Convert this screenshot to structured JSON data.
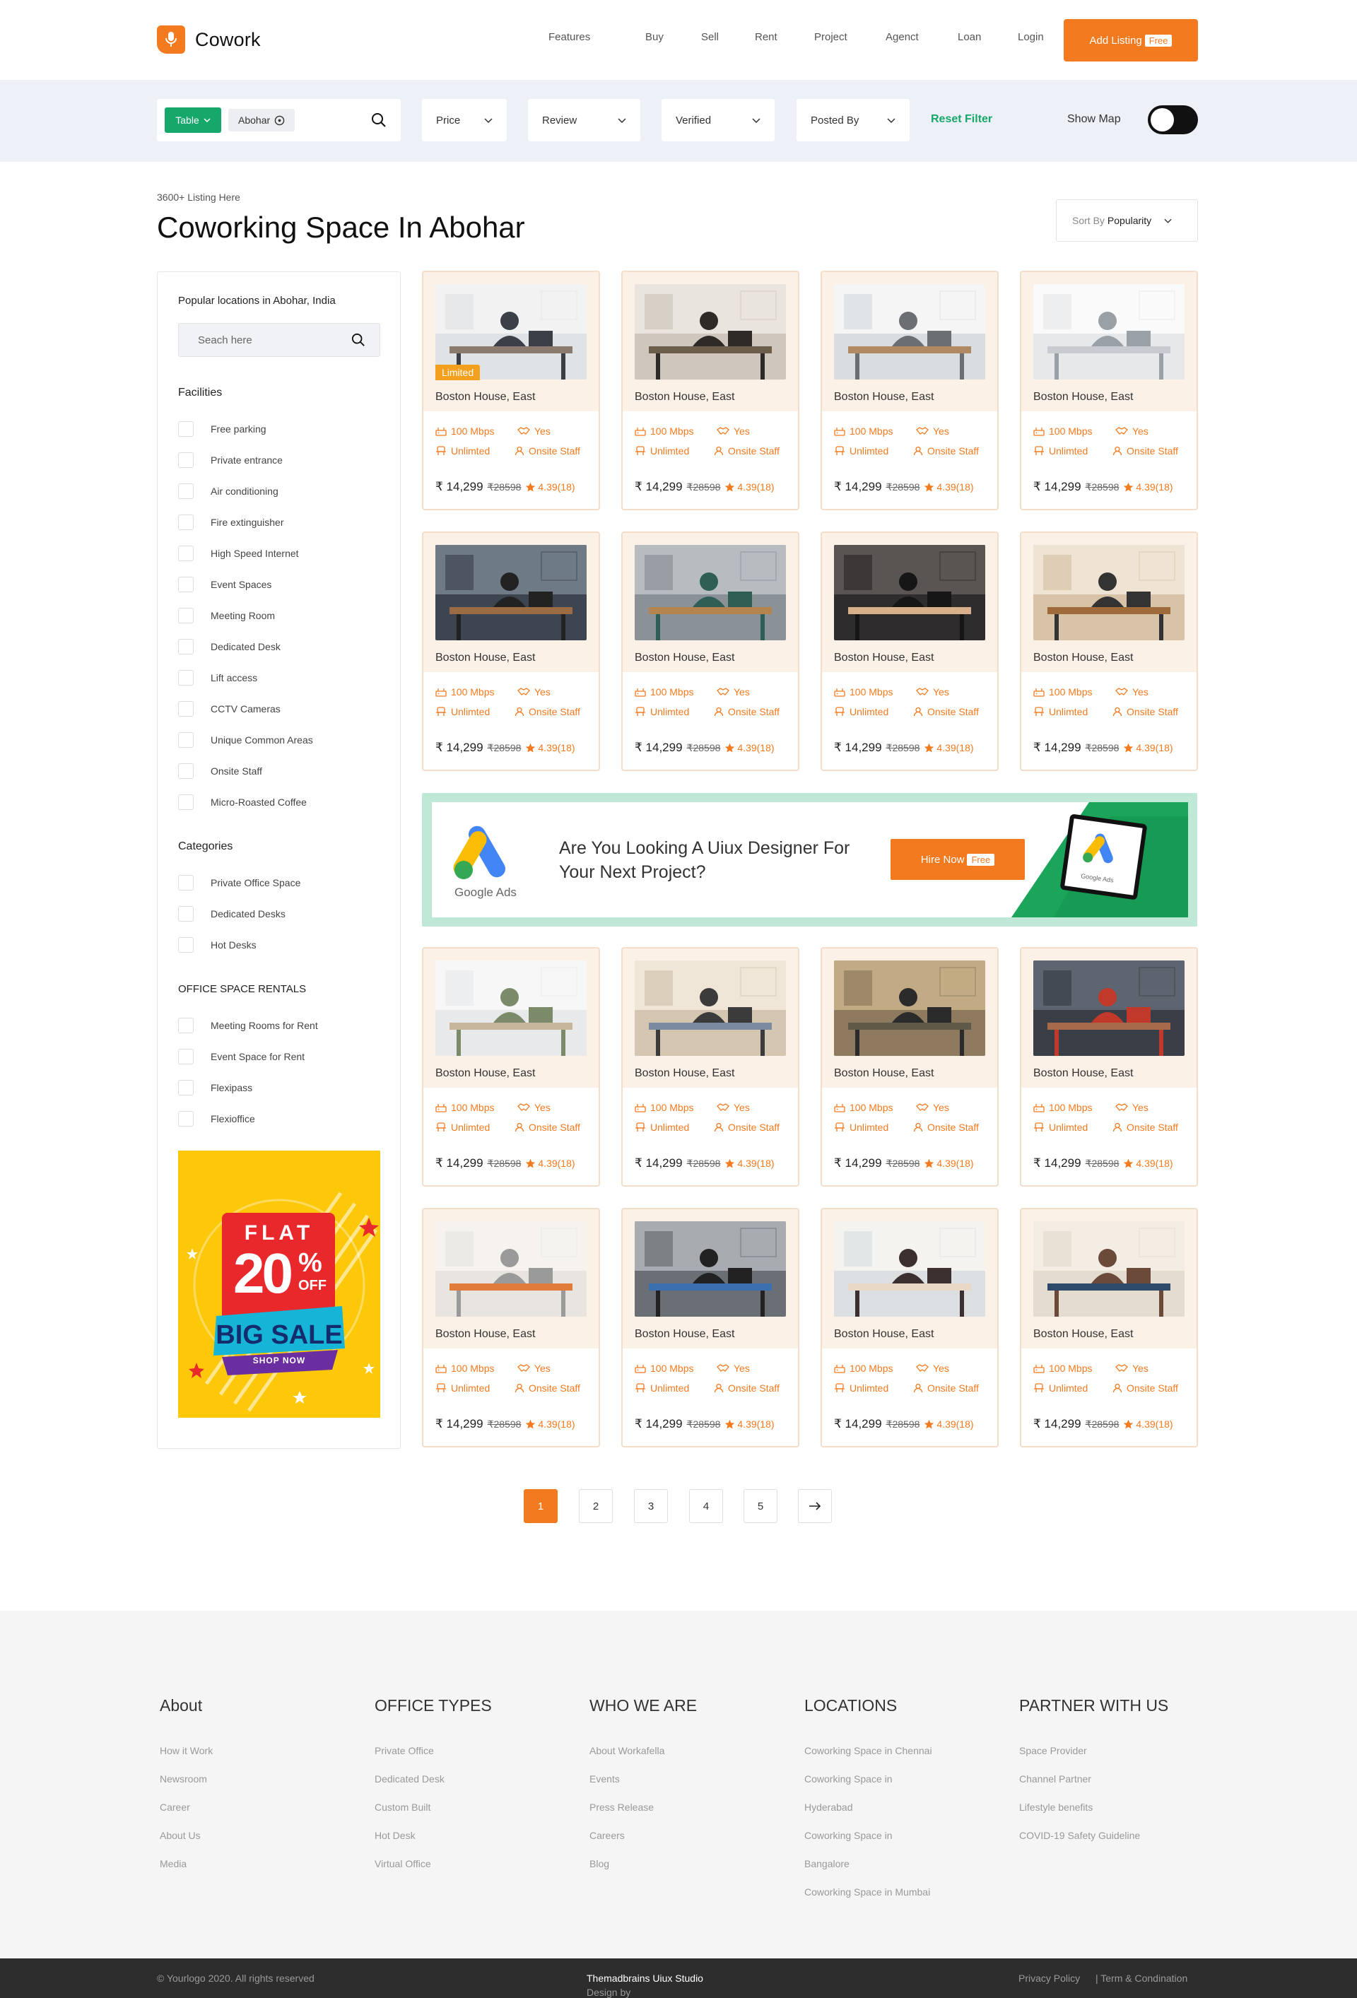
{
  "header": {
    "logo": "Cowork",
    "nav": [
      "Features",
      "Buy",
      "Sell",
      "Rent",
      "Project",
      "Agenct",
      "Loan",
      "Login"
    ],
    "cta": "Add Listing",
    "cta_tag": "Free"
  },
  "filters": {
    "view": "Table",
    "location": "Abohar",
    "dropdowns": [
      "Price",
      "Review",
      "Verified",
      "Posted By"
    ],
    "reset": "Reset Filter",
    "show_map": "Show Map"
  },
  "listing": {
    "count": "3600+ Listing Here",
    "title": "Coworking Space In Abohar",
    "sort_prefix": "Sort By",
    "sort_value": "Popularity"
  },
  "sidebar": {
    "popular_title": "Popular locations in Abohar, India",
    "search_placeholder": "Seach here",
    "facilities_title": "Facilities",
    "facilities": [
      "Free parking",
      "Private entrance",
      "Air conditioning",
      "Fire extinguisher",
      "High Speed Internet",
      "Event Spaces",
      "Meeting Room",
      "Dedicated Desk",
      "Lift access",
      "CCTV Cameras",
      "Unique Common Areas",
      "Onsite Staff",
      "Micro-Roasted Coffee"
    ],
    "categories_title": "Categories",
    "categories": [
      "Private Office Space",
      "Dedicated Desks",
      "Hot Desks"
    ],
    "rentals_title": "OFFICE SPACE RENTALS",
    "rentals": [
      "Meeting Rooms for Rent",
      "Event Space for Rent",
      "Flexipass",
      "Flexioffice"
    ],
    "promo": {
      "line1": "FLAT",
      "line2": "20",
      "pct": "%",
      "off": "OFF",
      "line3": "BIG SALE",
      "cta": "SHOP NOW"
    }
  },
  "card": {
    "name": "Boston House, East",
    "speed": "100 Mbps",
    "yes": "Yes",
    "seats": "Unlimted",
    "staff": "Onsite Staff",
    "price": "₹ 14,299",
    "old_price": "₹28598",
    "rating": "4.39(18)",
    "badge": "Limited"
  },
  "banner": {
    "brand": "Google Ads",
    "text": "Are You Looking A Uiux Designer For Your Next Project?",
    "cta": "Hire Now",
    "cta_tag": "Free"
  },
  "pagination": [
    "1",
    "2",
    "3",
    "4",
    "5"
  ],
  "footer": {
    "columns": [
      {
        "title": "About",
        "links": [
          "How it Work",
          "Newsroom",
          "Career",
          "About Us",
          "Media"
        ]
      },
      {
        "title": "OFFICE TYPES",
        "links": [
          "Private Office",
          "Dedicated Desk",
          "Custom Built",
          "Hot Desk",
          "Virtual Office"
        ]
      },
      {
        "title": "WHO WE ARE",
        "links": [
          "About Workafella",
          "Events",
          "Press Release",
          "Careers",
          "Blog"
        ]
      },
      {
        "title": "LOCATIONS",
        "links": [
          "Coworking Space in Chennai",
          "Coworking Space in",
          "Hyderabad",
          "Coworking Space in",
          "Bangalore",
          "Coworking Space in Mumbai"
        ]
      },
      {
        "title": "PARTNER WITH US",
        "links": [
          "Space Provider",
          "Channel Partner",
          "Lifestyle benefits",
          "COVID-19 Safety Guideline"
        ]
      }
    ],
    "copyright": "© Yourlogo 2020. All rights reserved",
    "design_by": "Design by",
    "studio": "Themadbrains Uiux Studio",
    "privacy": "Privacy Policy",
    "terms": "| Term & Condination"
  }
}
